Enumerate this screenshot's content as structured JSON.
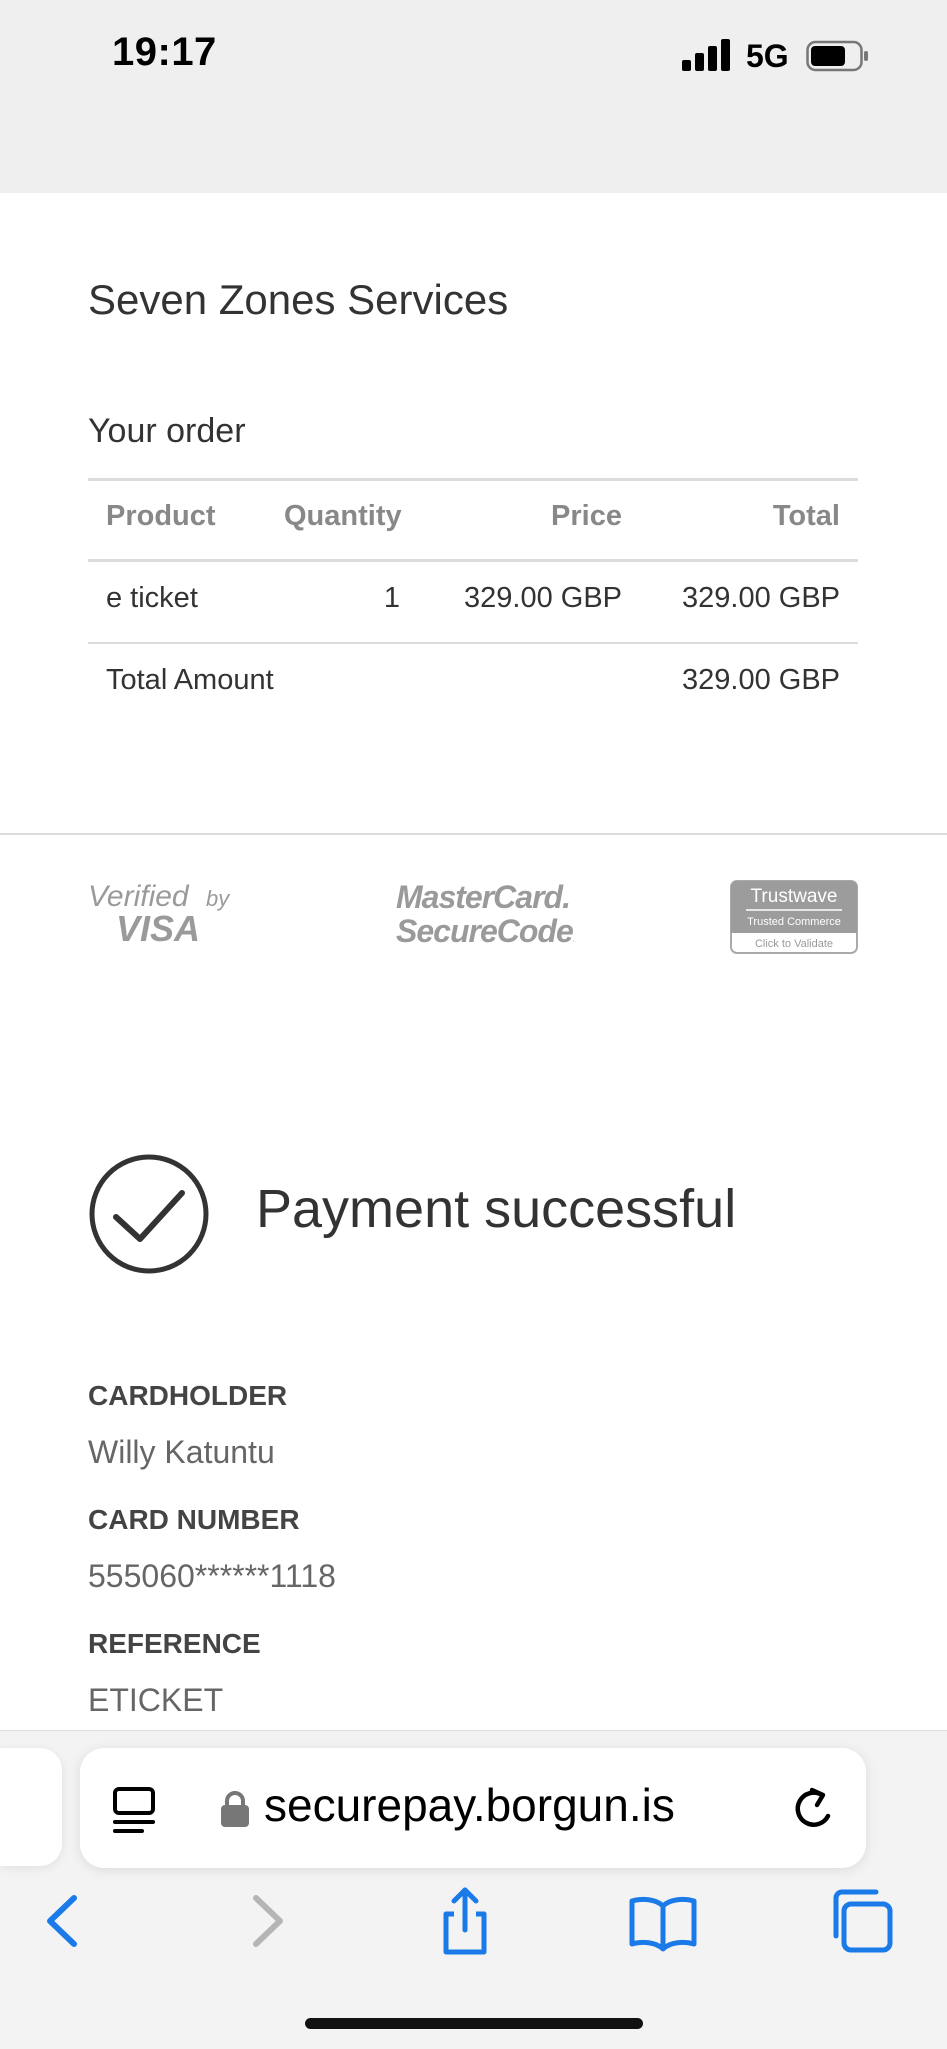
{
  "status_bar": {
    "time": "19:17",
    "network": "5G"
  },
  "merchant": "Seven Zones Services",
  "order": {
    "title": "Your order",
    "columns": [
      "Product",
      "Quantity",
      "Price",
      "Total"
    ],
    "rows": [
      {
        "product": "e ticket",
        "quantity": "1",
        "price": "329.00 GBP",
        "total": "329.00 GBP"
      }
    ],
    "total_label": "Total Amount",
    "total_value": "329.00 GBP"
  },
  "logos": {
    "visa": {
      "line1": "Verified",
      "line1b": "by",
      "line2": "VISA"
    },
    "mastercard": {
      "line1": "MasterCard.",
      "line2": "SecureCode."
    },
    "trustwave": {
      "line1": "Trustwave",
      "line2": "Trusted Commerce",
      "line3": "Click to Validate"
    }
  },
  "payment": {
    "status": "Payment successful",
    "fields": [
      {
        "label": "CARDHOLDER",
        "value": "Willy Katuntu"
      },
      {
        "label": "CARD NUMBER",
        "value": "555060******1118"
      },
      {
        "label": "REFERENCE",
        "value": "ETICKET"
      }
    ]
  },
  "browser": {
    "url": "securepay.borgun.is",
    "accent_color": "#1a7ae8",
    "disabled_color": "#b5b5b5"
  }
}
